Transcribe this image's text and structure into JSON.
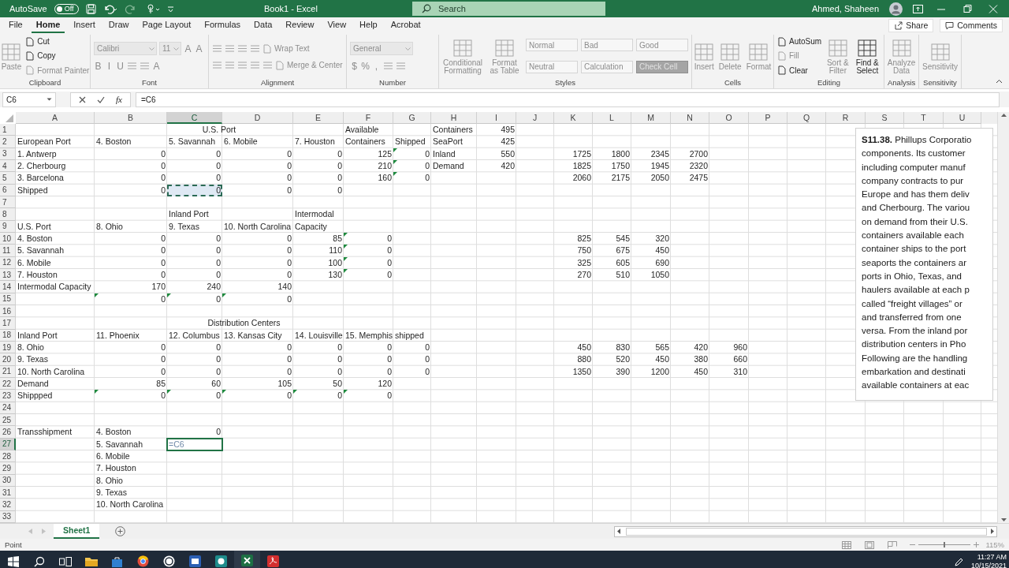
{
  "title_bar": {
    "autosave_label": "AutoSave",
    "autosave": {
      "label": "Off",
      "on": false
    },
    "title": "Book1 - Excel",
    "search_placeholder": "Search",
    "user": "Ahmed, Shaheen"
  },
  "tabs": [
    {
      "label": "File",
      "selected": false
    },
    {
      "label": "Home",
      "selected": true
    },
    {
      "label": "Insert",
      "selected": false
    },
    {
      "label": "Draw",
      "selected": false
    },
    {
      "label": "Page Layout",
      "selected": false
    },
    {
      "label": "Formulas",
      "selected": false
    },
    {
      "label": "Data",
      "selected": false
    },
    {
      "label": "Review",
      "selected": false
    },
    {
      "label": "View",
      "selected": false
    },
    {
      "label": "Help",
      "selected": false
    },
    {
      "label": "Acrobat",
      "selected": false
    }
  ],
  "share": "Share",
  "comments": "Comments",
  "ribbon": {
    "groups": [
      {
        "label": "Clipboard",
        "kind": "columns",
        "lines": [
          [
            {
              "kind": "large",
              "label": "Paste",
              "disabled": true
            }
          ],
          [
            {
              "kind": "small",
              "label": "Cut",
              "disabled": false
            },
            {
              "kind": "small",
              "label": "Copy",
              "disabled": false
            },
            {
              "kind": "small",
              "label": "Format Painter",
              "disabled": true
            }
          ]
        ]
      },
      {
        "label": "Font",
        "kind": "rows",
        "lines": [
          [
            {
              "kind": "wide-combo",
              "label": "Calibri",
              "disabled": true
            },
            {
              "kind": "combo",
              "label": "11",
              "disabled": true
            },
            {
              "kind": "glyph",
              "label": "A",
              "disabled": true
            },
            {
              "kind": "glyph",
              "label": "A",
              "disabled": true
            }
          ],
          [
            {
              "kind": "glyph",
              "label": "B",
              "disabled": true
            },
            {
              "kind": "glyph",
              "label": "I",
              "disabled": true
            },
            {
              "kind": "glyph",
              "label": "U",
              "disabled": true
            },
            {
              "kind": "icon",
              "disabled": true
            },
            {
              "kind": "icon",
              "disabled": true
            },
            {
              "kind": "glyph",
              "label": "A",
              "disabled": true
            }
          ]
        ]
      },
      {
        "label": "Alignment",
        "kind": "rows",
        "lines": [
          [
            {
              "kind": "icon",
              "disabled": true
            },
            {
              "kind": "icon",
              "disabled": true
            },
            {
              "kind": "icon",
              "disabled": true
            },
            {
              "kind": "icon",
              "disabled": true
            },
            {
              "kind": "small",
              "label": "Wrap Text",
              "disabled": true
            }
          ],
          [
            {
              "kind": "icon",
              "disabled": true
            },
            {
              "kind": "icon",
              "disabled": true
            },
            {
              "kind": "icon",
              "disabled": true
            },
            {
              "kind": "icon",
              "disabled": true
            },
            {
              "kind": "icon",
              "disabled": true
            },
            {
              "kind": "small",
              "label": "Merge & Center",
              "disabled": true
            }
          ]
        ]
      },
      {
        "label": "Number",
        "kind": "rows",
        "lines": [
          [
            {
              "kind": "wide-combo",
              "label": "General",
              "disabled": true
            }
          ],
          [
            {
              "kind": "glyph",
              "label": "$",
              "disabled": true
            },
            {
              "kind": "glyph",
              "label": "%",
              "disabled": true
            },
            {
              "kind": "glyph",
              "label": ",",
              "disabled": true
            },
            {
              "kind": "icon",
              "disabled": true
            },
            {
              "kind": "icon",
              "disabled": true
            }
          ]
        ]
      },
      {
        "label": "Styles",
        "kind": "columns",
        "lines": [
          [
            {
              "kind": "large",
              "label": "Conditional Formatting",
              "disabled": true
            }
          ],
          [
            {
              "kind": "large",
              "label": "Format as Table",
              "disabled": true
            }
          ],
          [
            {
              "kind": "style",
              "label": "Normal",
              "disabled": true
            },
            {
              "kind": "style",
              "label": "Neutral",
              "disabled": true
            }
          ],
          [
            {
              "kind": "style",
              "label": "Bad",
              "disabled": true
            },
            {
              "kind": "style",
              "label": "Calculation",
              "disabled": true
            }
          ],
          [
            {
              "kind": "style",
              "label": "Good",
              "disabled": true
            },
            {
              "kind": "dark-style",
              "label": "Check Cell",
              "disabled": true
            }
          ]
        ]
      },
      {
        "label": "Cells",
        "kind": "columns",
        "lines": [
          [
            {
              "kind": "large",
              "label": "Insert",
              "disabled": true
            }
          ],
          [
            {
              "kind": "large",
              "label": "Delete",
              "disabled": true
            }
          ],
          [
            {
              "kind": "large",
              "label": "Format",
              "disabled": true
            }
          ]
        ]
      },
      {
        "label": "Editing",
        "kind": "columns",
        "lines": [
          [
            {
              "kind": "small",
              "label": "AutoSum",
              "disabled": false
            },
            {
              "kind": "small",
              "label": "Fill",
              "disabled": true
            },
            {
              "kind": "small",
              "label": "Clear",
              "disabled": false
            }
          ],
          [
            {
              "kind": "large",
              "label": "Sort & Filter",
              "disabled": true
            }
          ],
          [
            {
              "kind": "large",
              "label": "Find & Select",
              "disabled": false
            }
          ]
        ]
      },
      {
        "label": "Analysis",
        "kind": "columns",
        "lines": [
          [
            {
              "kind": "large",
              "label": "Analyze Data",
              "disabled": true
            }
          ]
        ]
      },
      {
        "label": "Sensitivity",
        "kind": "columns",
        "lines": [
          [
            {
              "kind": "large",
              "label": "Sensitivity",
              "disabled": true
            }
          ]
        ]
      }
    ]
  },
  "formula_bar": {
    "name_box": "C6",
    "function_label": "fx",
    "formula": "=C6"
  },
  "sheet": {
    "columns": [
      "A",
      "B",
      "C",
      "D",
      "E",
      "F",
      "G",
      "H",
      "I",
      "J",
      "K",
      "L",
      "M",
      "N",
      "O",
      "P",
      "Q",
      "R",
      "S",
      "T",
      "U"
    ],
    "rows": [
      {
        "number": "1",
        "cells": [
          {
            "kind": "blank"
          },
          {
            "kind": "merged",
            "text": "U.S. Port"
          },
          {
            "kind": "covered"
          },
          {
            "kind": "covered"
          },
          {
            "kind": "covered"
          },
          {
            "kind": "text",
            "text": "Available"
          },
          {
            "kind": "blank"
          },
          {
            "kind": "text",
            "text": "Containers"
          },
          {
            "kind": "number",
            "text": "495"
          }
        ]
      },
      {
        "number": "2",
        "cells": [
          {
            "kind": "text",
            "text": "European Port"
          },
          {
            "kind": "text",
            "text": "4. Boston"
          },
          {
            "kind": "text",
            "text": "5. Savannah"
          },
          {
            "kind": "text",
            "text": "6. Mobile"
          },
          {
            "kind": "text",
            "text": "7. Houston"
          },
          {
            "kind": "text",
            "text": "Containers"
          },
          {
            "kind": "text",
            "text": "Shipped"
          },
          {
            "kind": "text",
            "text": "SeaPort"
          },
          {
            "kind": "number",
            "text": "425"
          }
        ]
      },
      {
        "number": "3",
        "cells": [
          {
            "kind": "text",
            "text": "1. Antwerp"
          },
          {
            "kind": "number",
            "text": "0"
          },
          {
            "kind": "number",
            "text": "0"
          },
          {
            "kind": "number",
            "text": "0"
          },
          {
            "kind": "number",
            "text": "0"
          },
          {
            "kind": "number",
            "text": "125"
          },
          {
            "kind": "flagged",
            "text": "0"
          },
          {
            "kind": "text",
            "text": "Inland"
          },
          {
            "kind": "number",
            "text": "550"
          },
          {
            "kind": "blank"
          },
          {
            "kind": "number",
            "text": "1725"
          },
          {
            "kind": "number",
            "text": "1800"
          },
          {
            "kind": "number",
            "text": "2345"
          },
          {
            "kind": "number",
            "text": "2700"
          }
        ]
      },
      {
        "number": "4",
        "cells": [
          {
            "kind": "text",
            "text": "2. Cherbourg"
          },
          {
            "kind": "number",
            "text": "0"
          },
          {
            "kind": "number",
            "text": "0"
          },
          {
            "kind": "number",
            "text": "0"
          },
          {
            "kind": "number",
            "text": "0"
          },
          {
            "kind": "number",
            "text": "210"
          },
          {
            "kind": "flagged",
            "text": "0"
          },
          {
            "kind": "text",
            "text": "Demand"
          },
          {
            "kind": "number",
            "text": "420"
          },
          {
            "kind": "blank"
          },
          {
            "kind": "number",
            "text": "1825"
          },
          {
            "kind": "number",
            "text": "1750"
          },
          {
            "kind": "number",
            "text": "1945"
          },
          {
            "kind": "number",
            "text": "2320"
          }
        ]
      },
      {
        "number": "5",
        "cells": [
          {
            "kind": "text",
            "text": "3. Barcelona"
          },
          {
            "kind": "number",
            "text": "0"
          },
          {
            "kind": "number",
            "text": "0"
          },
          {
            "kind": "number",
            "text": "0"
          },
          {
            "kind": "number",
            "text": "0"
          },
          {
            "kind": "number",
            "text": "160"
          },
          {
            "kind": "flagged",
            "text": "0"
          },
          {
            "kind": "blank"
          },
          {
            "kind": "blank"
          },
          {
            "kind": "blank"
          },
          {
            "kind": "number",
            "text": "2060"
          },
          {
            "kind": "number",
            "text": "2175"
          },
          {
            "kind": "number",
            "text": "2050"
          },
          {
            "kind": "number",
            "text": "2475"
          }
        ]
      },
      {
        "number": "6",
        "cells": [
          {
            "kind": "text",
            "text": "Shipped"
          },
          {
            "kind": "number",
            "text": "0"
          },
          {
            "kind": "referenced",
            "text": "0"
          },
          {
            "kind": "number",
            "text": "0"
          },
          {
            "kind": "number",
            "text": "0"
          }
        ]
      },
      {
        "number": "7"
      },
      {
        "number": "8",
        "cells": [
          {
            "kind": "blank"
          },
          {
            "kind": "blank"
          },
          {
            "kind": "text",
            "text": "Inland Port"
          },
          {
            "kind": "blank"
          },
          {
            "kind": "text",
            "text": "Intermodal"
          }
        ]
      },
      {
        "number": "9",
        "cells": [
          {
            "kind": "text",
            "text": "U.S. Port"
          },
          {
            "kind": "text",
            "text": "8. Ohio"
          },
          {
            "kind": "text",
            "text": "9. Texas"
          },
          {
            "kind": "text",
            "text": "10. North Carolina"
          },
          {
            "kind": "text",
            "text": "Capacity"
          }
        ]
      },
      {
        "number": "10",
        "cells": [
          {
            "kind": "text",
            "text": "4. Boston"
          },
          {
            "kind": "number",
            "text": "0"
          },
          {
            "kind": "number",
            "text": "0"
          },
          {
            "kind": "number",
            "text": "0"
          },
          {
            "kind": "number",
            "text": "85"
          },
          {
            "kind": "flagged",
            "text": "0"
          },
          {
            "kind": "blank"
          },
          {
            "kind": "blank"
          },
          {
            "kind": "blank"
          },
          {
            "kind": "blank"
          },
          {
            "kind": "number",
            "text": "825"
          },
          {
            "kind": "number",
            "text": "545"
          },
          {
            "kind": "number",
            "text": "320"
          }
        ]
      },
      {
        "number": "11",
        "cells": [
          {
            "kind": "text",
            "text": "5. Savannah"
          },
          {
            "kind": "number",
            "text": "0"
          },
          {
            "kind": "number",
            "text": "0"
          },
          {
            "kind": "number",
            "text": "0"
          },
          {
            "kind": "number",
            "text": "110"
          },
          {
            "kind": "flagged",
            "text": "0"
          },
          {
            "kind": "blank"
          },
          {
            "kind": "blank"
          },
          {
            "kind": "blank"
          },
          {
            "kind": "blank"
          },
          {
            "kind": "number",
            "text": "750"
          },
          {
            "kind": "number",
            "text": "675"
          },
          {
            "kind": "number",
            "text": "450"
          }
        ]
      },
      {
        "number": "12",
        "cells": [
          {
            "kind": "text",
            "text": "6. Mobile"
          },
          {
            "kind": "number",
            "text": "0"
          },
          {
            "kind": "number",
            "text": "0"
          },
          {
            "kind": "number",
            "text": "0"
          },
          {
            "kind": "number",
            "text": "100"
          },
          {
            "kind": "flagged",
            "text": "0"
          },
          {
            "kind": "blank"
          },
          {
            "kind": "blank"
          },
          {
            "kind": "blank"
          },
          {
            "kind": "blank"
          },
          {
            "kind": "number",
            "text": "325"
          },
          {
            "kind": "number",
            "text": "605"
          },
          {
            "kind": "number",
            "text": "690"
          }
        ]
      },
      {
        "number": "13",
        "cells": [
          {
            "kind": "text",
            "text": "7. Houston"
          },
          {
            "kind": "number",
            "text": "0"
          },
          {
            "kind": "number",
            "text": "0"
          },
          {
            "kind": "number",
            "text": "0"
          },
          {
            "kind": "number",
            "text": "130"
          },
          {
            "kind": "flagged",
            "text": "0"
          },
          {
            "kind": "blank"
          },
          {
            "kind": "blank"
          },
          {
            "kind": "blank"
          },
          {
            "kind": "blank"
          },
          {
            "kind": "number",
            "text": "270"
          },
          {
            "kind": "number",
            "text": "510"
          },
          {
            "kind": "number",
            "text": "1050"
          }
        ]
      },
      {
        "number": "14",
        "cells": [
          {
            "kind": "text",
            "text": "Intermodal Capacity"
          },
          {
            "kind": "number",
            "text": "170"
          },
          {
            "kind": "number",
            "text": "240"
          },
          {
            "kind": "number",
            "text": "140"
          }
        ]
      },
      {
        "number": "15",
        "cells": [
          {
            "kind": "blank"
          },
          {
            "kind": "flagged",
            "text": "0"
          },
          {
            "kind": "flagged",
            "text": "0"
          },
          {
            "kind": "flagged",
            "text": "0"
          }
        ]
      },
      {
        "number": "16"
      },
      {
        "number": "17",
        "cells": [
          {
            "kind": "blank"
          },
          {
            "kind": "merged",
            "text": "Distribution Centers"
          },
          {
            "kind": "covered"
          },
          {
            "kind": "covered"
          },
          {
            "kind": "covered"
          },
          {
            "kind": "covered"
          }
        ]
      },
      {
        "number": "18",
        "cells": [
          {
            "kind": "text",
            "text": "Inland Port"
          },
          {
            "kind": "text",
            "text": "11. Phoenix"
          },
          {
            "kind": "text",
            "text": "12. Columbus"
          },
          {
            "kind": "text",
            "text": "13. Kansas City"
          },
          {
            "kind": "text",
            "text": "14. Louisville"
          },
          {
            "kind": "text",
            "text": "15. Memphis"
          },
          {
            "kind": "text",
            "text": "shipped"
          }
        ]
      },
      {
        "number": "19",
        "cells": [
          {
            "kind": "text",
            "text": "8. Ohio"
          },
          {
            "kind": "number",
            "text": "0"
          },
          {
            "kind": "number",
            "text": "0"
          },
          {
            "kind": "number",
            "text": "0"
          },
          {
            "kind": "number",
            "text": "0"
          },
          {
            "kind": "number",
            "text": "0"
          },
          {
            "kind": "number",
            "text": "0"
          },
          {
            "kind": "blank"
          },
          {
            "kind": "blank"
          },
          {
            "kind": "blank"
          },
          {
            "kind": "number",
            "text": "450"
          },
          {
            "kind": "number",
            "text": "830"
          },
          {
            "kind": "number",
            "text": "565"
          },
          {
            "kind": "number",
            "text": "420"
          },
          {
            "kind": "number",
            "text": "960"
          }
        ]
      },
      {
        "number": "20",
        "cells": [
          {
            "kind": "text",
            "text": "9. Texas"
          },
          {
            "kind": "number",
            "text": "0"
          },
          {
            "kind": "number",
            "text": "0"
          },
          {
            "kind": "number",
            "text": "0"
          },
          {
            "kind": "number",
            "text": "0"
          },
          {
            "kind": "number",
            "text": "0"
          },
          {
            "kind": "number",
            "text": "0"
          },
          {
            "kind": "blank"
          },
          {
            "kind": "blank"
          },
          {
            "kind": "blank"
          },
          {
            "kind": "number",
            "text": "880"
          },
          {
            "kind": "number",
            "text": "520"
          },
          {
            "kind": "number",
            "text": "450"
          },
          {
            "kind": "number",
            "text": "380"
          },
          {
            "kind": "number",
            "text": "660"
          }
        ]
      },
      {
        "number": "21",
        "cells": [
          {
            "kind": "text",
            "text": "10. North Carolina"
          },
          {
            "kind": "number",
            "text": "0"
          },
          {
            "kind": "number",
            "text": "0"
          },
          {
            "kind": "number",
            "text": "0"
          },
          {
            "kind": "number",
            "text": "0"
          },
          {
            "kind": "number",
            "text": "0"
          },
          {
            "kind": "number",
            "text": "0"
          },
          {
            "kind": "blank"
          },
          {
            "kind": "blank"
          },
          {
            "kind": "blank"
          },
          {
            "kind": "number",
            "text": "1350"
          },
          {
            "kind": "number",
            "text": "390"
          },
          {
            "kind": "number",
            "text": "1200"
          },
          {
            "kind": "number",
            "text": "450"
          },
          {
            "kind": "number",
            "text": "310"
          }
        ]
      },
      {
        "number": "22",
        "cells": [
          {
            "kind": "text",
            "text": "Demand"
          },
          {
            "kind": "number",
            "text": "85"
          },
          {
            "kind": "number",
            "text": "60"
          },
          {
            "kind": "number",
            "text": "105"
          },
          {
            "kind": "number",
            "text": "50"
          },
          {
            "kind": "number",
            "text": "120"
          }
        ]
      },
      {
        "number": "23",
        "cells": [
          {
            "kind": "text",
            "text": "Shippped"
          },
          {
            "kind": "flagged",
            "text": "0"
          },
          {
            "kind": "flagged",
            "text": "0"
          },
          {
            "kind": "flagged",
            "text": "0"
          },
          {
            "kind": "flagged",
            "text": "0"
          },
          {
            "kind": "flagged",
            "text": "0"
          }
        ]
      },
      {
        "number": "24"
      },
      {
        "number": "25"
      },
      {
        "number": "26",
        "cells": [
          {
            "kind": "text",
            "text": "Transshipment"
          },
          {
            "kind": "text",
            "text": "4. Boston"
          },
          {
            "kind": "number",
            "text": "0"
          }
        ]
      },
      {
        "number": "27",
        "cells": [
          {
            "kind": "blank"
          },
          {
            "kind": "text",
            "text": "5. Savannah"
          },
          {
            "kind": "editing",
            "text": "=C6"
          }
        ]
      },
      {
        "number": "28",
        "cells": [
          {
            "kind": "blank"
          },
          {
            "kind": "text",
            "text": "6. Mobile"
          }
        ]
      },
      {
        "number": "29",
        "cells": [
          {
            "kind": "blank"
          },
          {
            "kind": "text",
            "text": "7. Houston"
          }
        ]
      },
      {
        "number": "30",
        "cells": [
          {
            "kind": "blank"
          },
          {
            "kind": "text",
            "text": "8. Ohio"
          }
        ]
      },
      {
        "number": "31",
        "cells": [
          {
            "kind": "blank"
          },
          {
            "kind": "text",
            "text": "9. Texas"
          }
        ]
      },
      {
        "number": "32",
        "cells": [
          {
            "kind": "blank"
          },
          {
            "kind": "text",
            "text": "10. North Carolina"
          }
        ]
      },
      {
        "number": "33"
      }
    ]
  },
  "note": {
    "lines": [
      "**S11.38.** Phillups Corporatio",
      "components. Its customer",
      "including computer manuf",
      "company contracts to pur",
      "Europe and has them deliv",
      "and Cherbourg. The variou",
      "on demand from their U.S.",
      "containers available each",
      "container ships to the port",
      "seaports the containers ar",
      "ports in Ohio, Texas, and",
      "haulers available at each p",
      "called “freight villages” or",
      "and transferred from one",
      "versa. From the inland por",
      "distribution centers in Pho",
      "Following are the handling",
      "embarkation and destinati",
      "available containers at eac"
    ]
  },
  "sheet_tabs": [
    {
      "label": "Sheet1",
      "selected": true
    }
  ],
  "status_bar": {
    "mode": "Point",
    "zoom": {
      "level": 0.5,
      "reading": "115%"
    }
  },
  "taskbar": {
    "time": "11:27 AM",
    "date": "10/15/2021"
  }
}
